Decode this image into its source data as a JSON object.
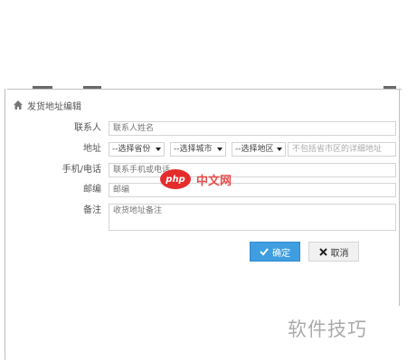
{
  "dialog": {
    "title": "发货地址编辑",
    "icon": "home-icon"
  },
  "form": {
    "contact": {
      "label": "联系人",
      "placeholder": "联系人姓名"
    },
    "address": {
      "label": "地址",
      "province": "--选择省份",
      "city": "--选择城市",
      "district": "--选择地区",
      "hint": "不包括省市区的详细地址"
    },
    "phone": {
      "label": "手机/电话",
      "placeholder": "联系手机或电话"
    },
    "postcode": {
      "label": "邮编",
      "placeholder": "邮编"
    },
    "remark": {
      "label": "备注",
      "placeholder": "收货地址备注"
    }
  },
  "buttons": {
    "confirm": "确定",
    "cancel": "取消"
  },
  "watermarks": {
    "php_badge": "php",
    "php_site": "中文网",
    "corner": "软件技巧"
  },
  "colors": {
    "primary": "#3e9ee0",
    "php_red": "#e52c2c"
  }
}
